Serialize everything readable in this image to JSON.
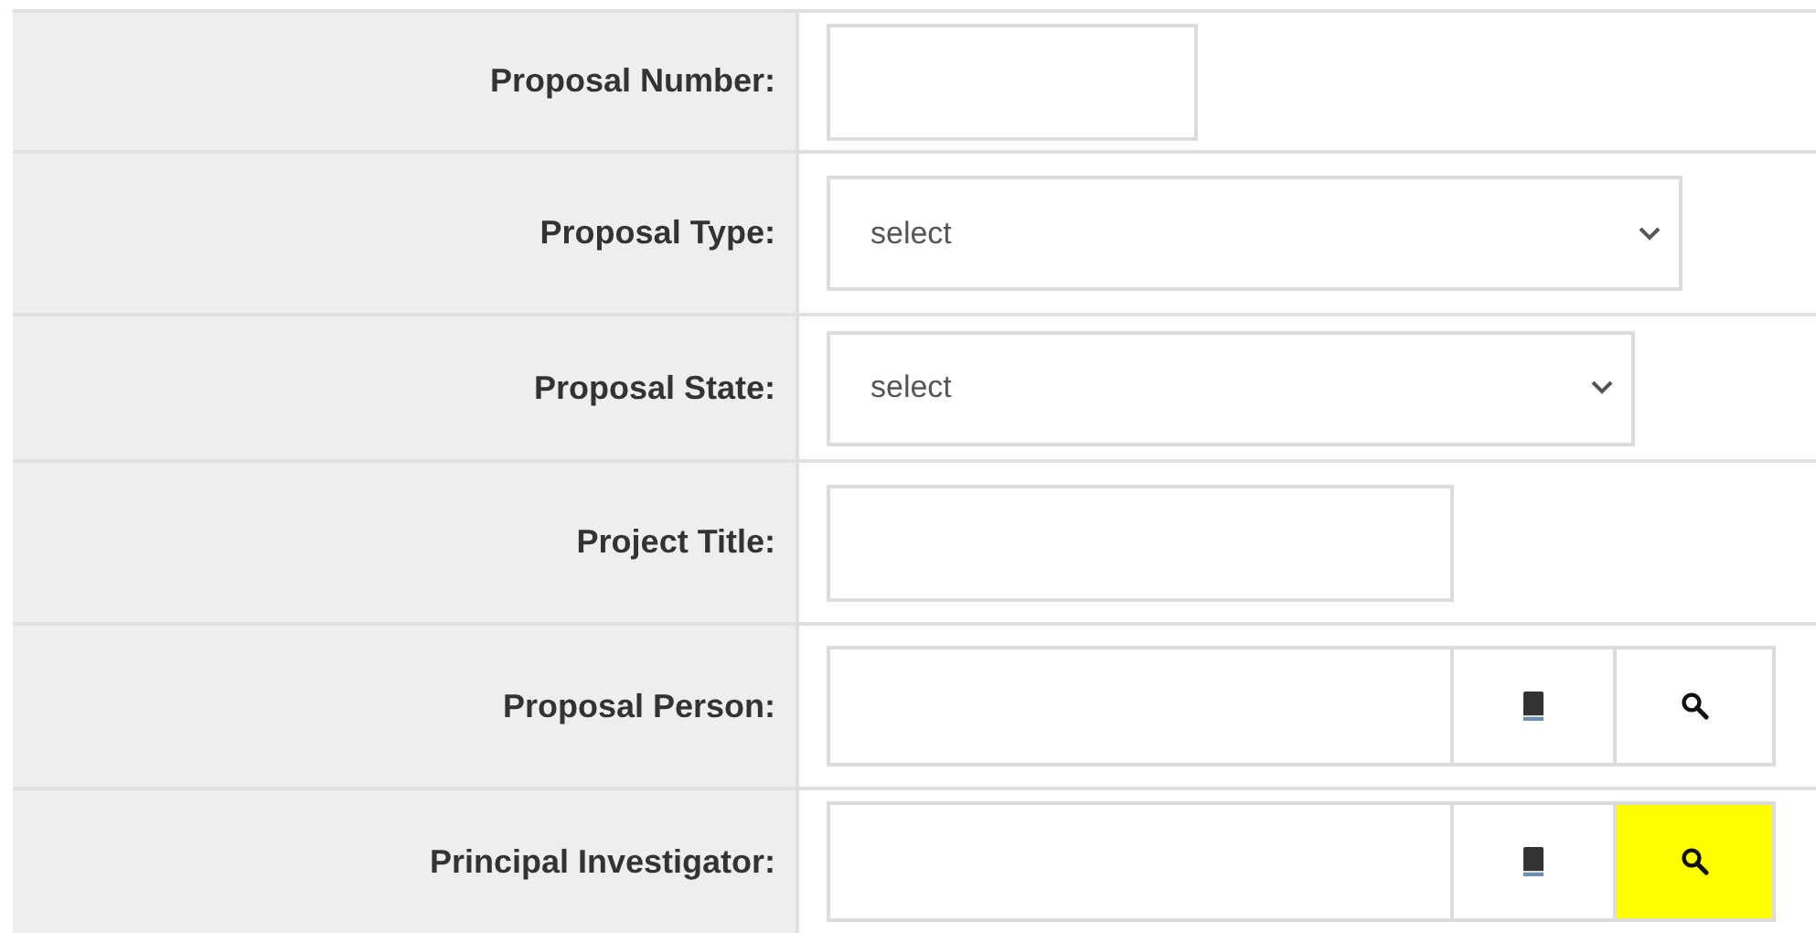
{
  "fields": [
    {
      "label": "Proposal Number:",
      "kind": "text"
    },
    {
      "label": "Proposal Type:",
      "kind": "select",
      "value": "select"
    },
    {
      "label": "Proposal State:",
      "kind": "select",
      "value": "select"
    },
    {
      "label": "Project Title:",
      "kind": "text"
    },
    {
      "label": "Proposal Person:",
      "kind": "lookup",
      "search_highlighted": false
    },
    {
      "label": "Principal Investigator:",
      "kind": "lookup",
      "search_highlighted": true
    }
  ]
}
